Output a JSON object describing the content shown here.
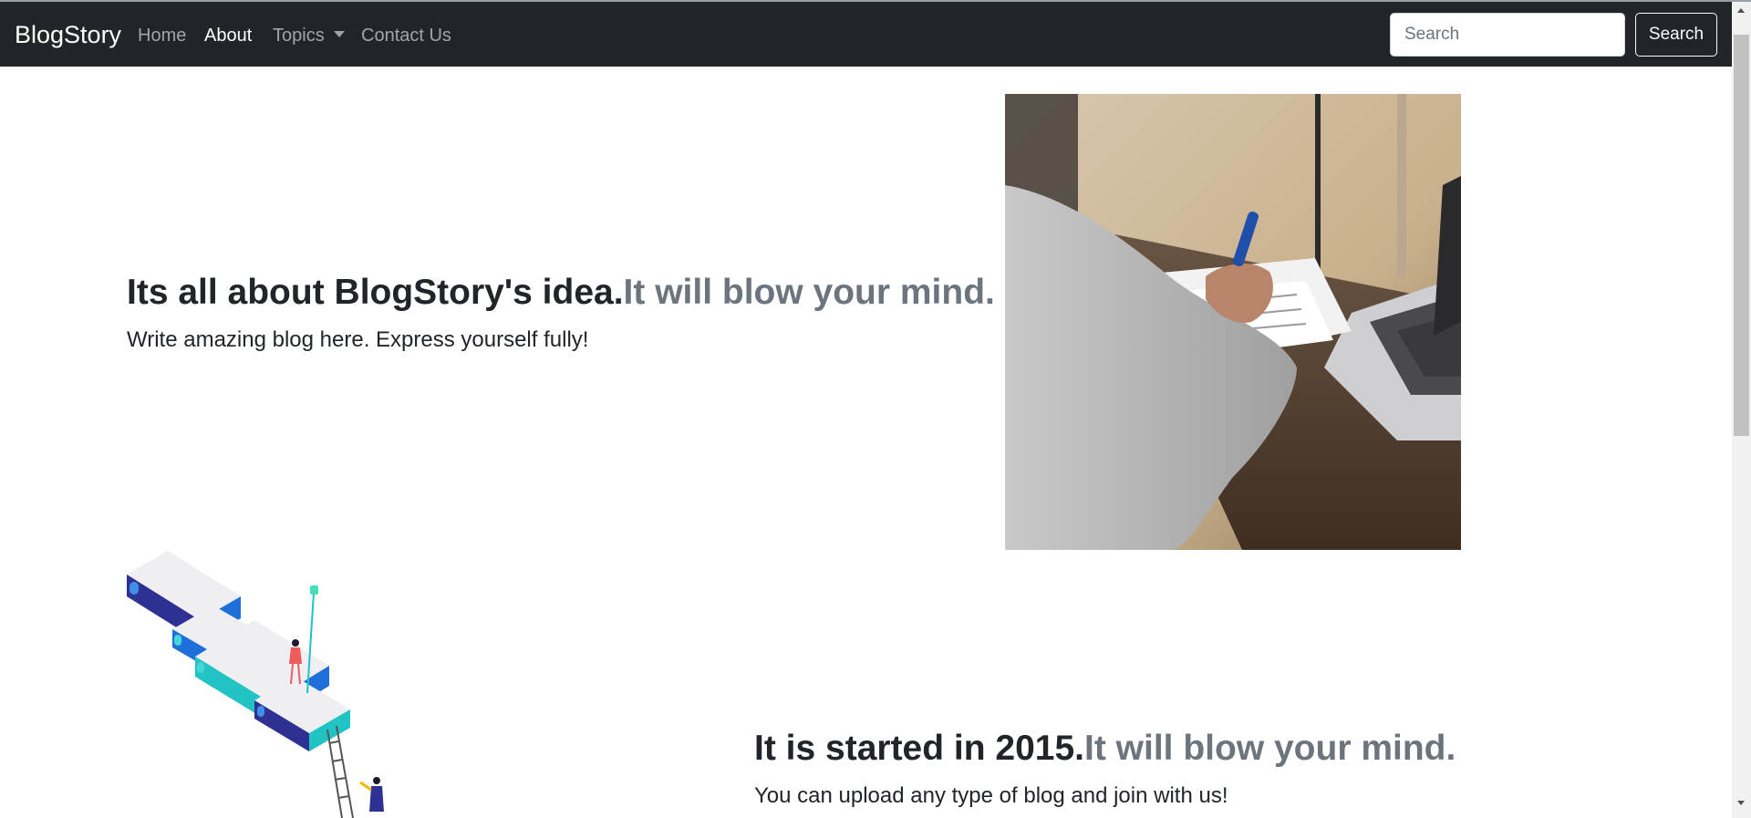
{
  "navbar": {
    "brand": "BlogStory",
    "links": [
      {
        "label": "Home"
      },
      {
        "label": "About"
      },
      {
        "label": "Topics"
      },
      {
        "label": "Contact Us"
      }
    ],
    "active_link": "About",
    "search_placeholder": "Search",
    "search_button": "Search"
  },
  "features": [
    {
      "heading": "Its all about BlogStory's idea.",
      "heading_muted": "It will blow your mind.",
      "lead": "Write amazing blog here. Express yourself fully!"
    },
    {
      "heading": "It is started in 2015.",
      "heading_muted": "It will blow your mind.",
      "lead": "You can upload any type of blog and join with us!"
    }
  ],
  "colors": {
    "navbar_bg": "#212529",
    "text_dark": "#212529",
    "text_muted": "#6c757d"
  }
}
